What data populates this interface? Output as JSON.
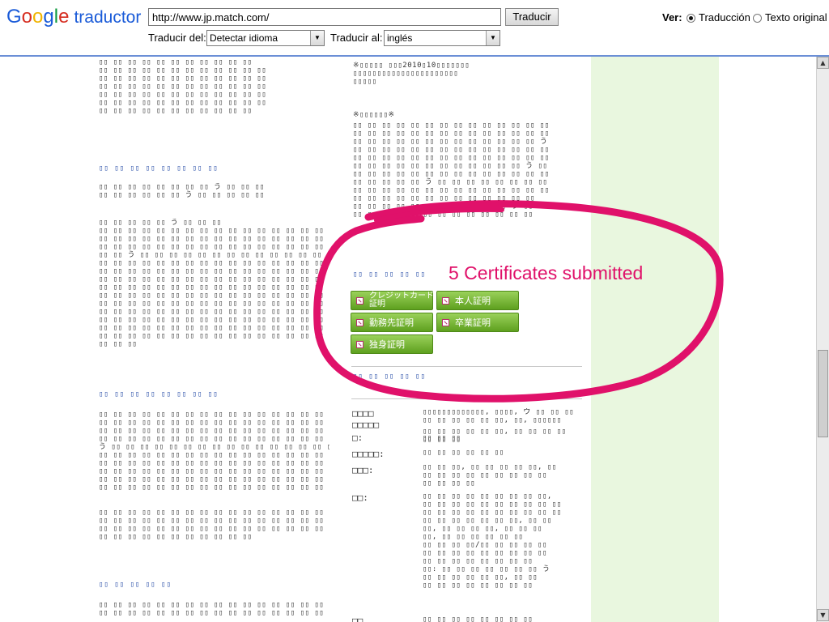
{
  "toolbar": {
    "logo_google": "Google",
    "logo_product": "traductor",
    "url_value": "http://www.jp.match.com/",
    "translate_button": "Traducir",
    "from_label": "Traducir del:",
    "from_value": "Detectar idioma",
    "to_label": "Traducir al:",
    "to_value": "inglés",
    "view_label": "Ver:",
    "view_translation": "Traducción",
    "view_original": "Texto original"
  },
  "content": {
    "left_block_1": "▯▯ ▯▯ ▯▯ ▯▯ ▯▯ ▯▯ ▯▯ ▯▯ ▯▯ ▯▯ ▯▯\n▯▯ ▯▯ ▯▯ ▯▯ ▯▯ ▯▯ ▯▯ ▯▯ ▯▯ ▯▯ ▯▯ ▯▯\n▯▯ ▯▯ ▯▯ ▯▯ ▯▯ ▯▯ ▯▯ ▯▯ ▯▯ ▯▯ ▯▯ ▯▯\n▯▯ ▯▯ ▯▯ ▯▯ ▯▯ ▯▯ ▯▯ ▯▯ ▯▯ ▯▯ ▯▯ ▯▯\n▯▯ ▯▯ ▯▯ ▯▯ ▯▯ ▯▯ ▯▯ ▯▯ ▯▯ ▯▯ ▯▯ ▯▯\n▯▯ ▯▯ ▯▯ ▯▯ ▯▯ ▯▯ ▯▯ ▯▯ ▯▯ ▯▯ ▯▯ ▯▯\n▯▯ ▯▯ ▯▯ ▯▯ ▯▯ ▯▯ ▯▯ ▯▯ ▯▯ ▯▯ ▯▯",
    "left_head_1": "▯▯ ▯▯ ▯▯ ▯▯ ▯▯ ▯▯ ▯▯ ▯▯",
    "left_block_2": "▯▯ ▯▯ ▯▯ ▯▯ ▯▯ ▯▯ ▯▯ ▯▯ う ▯▯ ▯▯ ▯▯\n▯▯ ▯▯ ▯▯ ▯▯ ▯▯ ▯▯ う ▯▯ ▯▯ ▯▯ ▯▯ ▯▯",
    "left_block_3": "▯▯ ▯▯ ▯▯ ▯▯ ▯▯ う ▯▯ ▯▯ ▯▯\n▯▯ ▯▯ ▯▯ ▯▯ ▯▯ ▯▯ ▯▯ ▯▯ ▯▯ ▯▯ ▯▯ ▯▯ ▯▯ ▯▯ ▯▯ ▯▯ ▯▯\n▯▯ ▯▯ ▯▯ ▯▯ ▯▯ ▯▯ ▯▯ ▯▯ ▯▯ ▯▯ ▯▯ ▯▯ ▯▯ ▯▯ ▯▯ ▯▯ ▯▯\n▯▯ ▯▯ ▯▯ ▯▯ ▯▯ ▯▯ ▯▯ ▯▯ ▯▯ ▯▯ ▯▯ ▯▯ ▯▯ ▯▯ ▯▯ ▯▯ ▯▯\n▯▯ ▯▯ う ▯▯ ▯▯ ▯▯ ▯▯ ▯▯ ▯▯ ▯▯ ▯▯ ▯▯ ▯▯ ▯▯ ▯▯ ▯▯ ▯▯\n▯▯ ▯▯ ▯▯ ▯▯ ▯▯ ▯▯ ▯▯ ▯▯ ▯▯ ▯▯ ▯▯ ▯▯ ▯▯ ▯▯ ▯▯ ▯▯ ▯▯\n▯▯ ▯▯ ▯▯ ▯▯ ▯▯ ▯▯ ▯▯ ▯▯ ▯▯ ▯▯ ▯▯ ▯▯ ▯▯ ▯▯ ▯▯ ▯▯ ▯▯\n▯▯ ▯▯ ▯▯ ▯▯ ▯▯ ▯▯ ▯▯ ▯▯ ▯▯ ▯▯ ▯▯ ▯▯ ▯▯ ▯▯ ▯▯ ▯▯ ▯▯\n▯▯ ▯▯ ▯▯ ▯▯ ▯▯ ▯▯ ▯▯ ▯▯ ▯▯ ▯▯ ▯▯ ▯▯ ▯▯ ▯▯ ▯▯ ▯▯ ▯▯\n▯▯ ▯▯ ▯▯ ▯▯ ▯▯ ▯▯ ▯▯ ▯▯ ▯▯ ▯▯ ▯▯ ▯▯ ▯▯ ▯▯ ▯▯ ▯▯ ▯▯\n▯▯ ▯▯ ▯▯ ▯▯ ▯▯ ▯▯ ▯▯ ▯▯ ▯▯ ▯▯ ▯▯ ▯▯ ▯▯ ▯▯ ▯▯ ▯▯ ▯▯\n▯▯ ▯▯ ▯▯ ▯▯ ▯▯ ▯▯ ▯▯ ▯▯ ▯▯ ▯▯ ▯▯ ▯▯ ▯▯ ▯▯ ▯▯ ▯▯ ▯▯\n▯▯ ▯▯ ▯▯ ▯▯ ▯▯ ▯▯ ▯▯ ▯▯ ▯▯ ▯▯ ▯▯ ▯▯ ▯▯ ▯▯ ▯▯ ▯▯ ▯▯\n▯▯ ▯▯ ▯▯ ▯▯ ▯▯ ▯▯ ▯▯ ▯▯ ▯▯ ▯▯ ▯▯ ▯▯ ▯▯ ▯▯ ▯▯ ▯▯ ▯▯\n▯▯ ▯▯ ▯▯ ▯▯ ▯▯ ▯▯ ▯▯ ▯▯ ▯▯ ▯▯ ▯▯ ▯▯ ▯▯ ▯▯ ▯▯ ▯▯ ▯▯\n▯▯ ▯▯ ▯▯",
    "left_head_2": "▯▯ ▯▯ ▯▯ ▯▯ ▯▯ ▯▯ ▯▯ ▯▯",
    "left_block_4": "▯▯ ▯▯ ▯▯ ▯▯ ▯▯ ▯▯ ▯▯ ▯▯ ▯▯ ▯▯ ▯▯ ▯▯ ▯▯ ▯▯ ▯▯ ▯▯ ▯▯\n▯▯ ▯▯ ▯▯ ▯▯ ▯▯ ▯▯ ▯▯ ▯▯ ▯▯ ▯▯ ▯▯ ▯▯ ▯▯ ▯▯ ▯▯ ▯▯ ▯▯\n▯▯ ▯▯ ▯▯ ▯▯ ▯▯ ▯▯ ▯▯ ▯▯ ▯▯ ▯▯ ▯▯ ▯▯ ▯▯ ▯▯ ▯▯ ▯▯ ▯▯\n▯▯ ▯▯ ▯▯ ▯▯ ▯▯ ▯▯ ▯▯ ▯▯ ▯▯ ▯▯ ▯▯ ▯▯ ▯▯ ▯▯ ▯▯ ▯▯ ▯▯\nう ▯▯ ▯▯ ▯▯ ▯▯ ▯▯ ▯▯ ▯▯ ▯▯ ▯▯ ▯▯ ▯▯ ▯▯ ▯▯ ▯▯ ▯▯ ▯▯\n▯▯ ▯▯ ▯▯ ▯▯ ▯▯ ▯▯ ▯▯ ▯▯ ▯▯ ▯▯ ▯▯ ▯▯ ▯▯ ▯▯ ▯▯ ▯▯ ▯▯\n▯▯ ▯▯ ▯▯ ▯▯ ▯▯ ▯▯ ▯▯ ▯▯ ▯▯ ▯▯ ▯▯ ▯▯ ▯▯ ▯▯ ▯▯ ▯▯ ▯▯\n▯▯ ▯▯ ▯▯ ▯▯ ▯▯ ▯▯ ▯▯ ▯▯ ▯▯ ▯▯ ▯▯ ▯▯ ▯▯ ▯▯ ▯▯ ▯▯ ▯▯\n▯▯ ▯▯ ▯▯ ▯▯ ▯▯ ▯▯ ▯▯ ▯▯ ▯▯ ▯▯ ▯▯ ▯▯ ▯▯ ▯▯ ▯▯ ▯▯ ▯▯\n▯▯ ▯▯ ▯▯ ▯▯ ▯▯ ▯▯ ▯▯ ▯▯ ▯▯ ▯▯ ▯▯ ▯▯ ▯▯ ▯▯ ▯▯ ▯▯",
    "left_block_5": "▯▯ ▯▯ ▯▯ ▯▯ ▯▯ ▯▯ ▯▯ ▯▯ ▯▯ ▯▯ ▯▯ ▯▯ ▯▯ ▯▯ ▯▯ ▯▯ ▯▯\n▯▯ ▯▯ ▯▯ ▯▯ ▯▯ ▯▯ ▯▯ ▯▯ ▯▯ ▯▯ ▯▯ ▯▯ ▯▯ ▯▯ ▯▯ ▯▯ ▯▯\n▯▯ ▯▯ ▯▯ ▯▯ ▯▯ ▯▯ ▯▯ ▯▯ ▯▯ ▯▯ ▯▯ ▯▯ ▯▯ ▯▯ ▯▯ ▯▯ ▯▯\n▯▯ ▯▯ ▯▯ ▯▯ ▯▯ ▯▯ ▯▯ ▯▯ ▯▯ ▯▯ ▯▯",
    "left_head_3": "▯▯ ▯▯ ▯▯ ▯▯ ▯▯",
    "left_block_6": "▯▯ ▯▯ ▯▯ ▯▯ ▯▯ ▯▯ ▯▯ ▯▯ ▯▯ ▯▯ ▯▯ ▯▯ ▯▯ ▯▯ ▯▯ ▯▯ ▯▯\n▯▯ ▯▯ ▯▯ ▯▯ ▯▯ ▯▯ ▯▯ ▯▯ ▯▯ ▯▯ ▯▯ ▯▯ ▯▯ ▯▯ ▯▯ ▯▯ ▯▯",
    "right_notice_1": "※▯▯▯▯▯ ▯▯▯2010▯10▯▯▯▯▯▯▯\n▯▯▯▯▯▯▯▯▯▯▯▯▯▯▯▯▯▯▯▯▯▯\n▯▯▯▯▯",
    "right_notice_2_head": "※▯▯▯▯▯▯※",
    "right_block_2": "▯▯ ▯▯ ▯▯ ▯▯ ▯▯ ▯▯ ▯▯ ▯▯ ▯▯ ▯▯ ▯▯ ▯▯ ▯▯ ▯▯\n▯▯ ▯▯ ▯▯ ▯▯ ▯▯ ▯▯ ▯▯ ▯▯ ▯▯ ▯▯ ▯▯ ▯▯ ▯▯ ▯▯\n▯▯ ▯▯ ▯▯ ▯▯ ▯▯ ▯▯ ▯▯ ▯▯ ▯▯ ▯▯ ▯▯ ▯▯ ▯▯ う\n▯▯ ▯▯ ▯▯ ▯▯ ▯▯ ▯▯ ▯▯ ▯▯ ▯▯ ▯▯ ▯▯ ▯▯ ▯▯ ▯▯\n▯▯ ▯▯ ▯▯ ▯▯ ▯▯ ▯▯ ▯▯ ▯▯ ▯▯ ▯▯ ▯▯ ▯▯ ▯▯ ▯▯\n▯▯ ▯▯ ▯▯ ▯▯ ▯▯ ▯▯ ▯▯ ▯▯ ▯▯ ▯▯ ▯▯ ▯▯ う ▯▯\n▯▯ ▯▯ ▯▯ ▯▯ ▯▯ ▯▯ ▯▯ ▯▯ ▯▯ ▯▯ ▯▯ ▯▯ ▯▯ ▯▯\n▯▯ ▯▯ ▯▯ ▯▯ ▯▯ う ▯▯ ▯▯ ▯▯ ▯▯ ▯▯ ▯▯ ▯▯ ▯▯\n▯▯ ▯▯ ▯▯ ▯▯ ▯▯ ▯▯ ▯▯ ▯▯ ▯▯ ▯▯ ▯▯ ▯▯ ▯▯ ▯▯\n▯▯ ▯▯ ▯▯ ▯▯ ▯▯ ▯▯ ▯▯ ▯▯ ▯▯ ▯▯ ▯▯ ▯▯ ▯▯\n▯▯ ▯▯ ▯▯ ▯▯ ▯▯ ▯▯ ▯▯ ▯▯ ▯▯ ▯▯ ▯▯ う ▯▯\n▯▯ ▯▯ ウ ▯▯ ▯▯ ▯▯ ▯▯ ▯▯ ▯▯ ▯▯ ▯▯ ▯▯ ▯▯",
    "right_cert_head": "▯▯ ▯▯ ▯▯ ▯▯ ▯▯",
    "right_head_below": "▯▯ ▯▯ ▯▯ ▯▯ ▯▯",
    "table_rows": [
      {
        "label": "□□□□",
        "value": "▯▯▯▯▯▯▯▯▯▯▯▯▯, ▯▯▯▯, ウ ▯▯ ▯▯ ▯▯\n▯▯ ▯▯ ▯▯ ▯▯ ▯▯ ▯▯, ▯▯, ▯▯▯▯▯▯"
      },
      {
        "label": "□□□□□",
        "value": "▯▯ ▯▯ ▯▯ ▯▯ ▯▯ ▯▯, ▯▯ ▯▯ ▯▯ ▯▯\n▯▯ ▯▯ ▯▯"
      },
      {
        "label": "□:",
        "value": "▯▯ ▯▯ ▯▯"
      },
      {
        "label": "□□□□□:",
        "value": "▯▯ ▯▯ ▯▯ ▯▯ ▯▯ ▯▯"
      },
      {
        "label": "□□□:",
        "value": "▯▯ ▯▯ ▯▯, ▯▯ ▯▯ ▯▯ ▯▯ ▯▯, ▯▯\n▯▯ ▯▯ ▯▯ ▯▯ ▯▯ ▯▯ ▯▯ ▯▯ ▯▯\n▯▯ ▯▯ ▯▯ ▯▯"
      },
      {
        "label": "□□:",
        "value": "▯▯ ▯▯ ▯▯ ▯▯ ▯▯ ▯▯ ▯▯ ▯▯ ▯▯,\n▯▯ ▯▯ ▯▯ ▯▯ ▯▯ ▯▯ ▯▯ ▯▯ ▯▯ ▯▯\n▯▯ ▯▯ ▯▯ ▯▯ ▯▯ ▯▯ ▯▯ ▯▯ ▯▯ ▯▯\n▯▯ ▯▯ ▯▯ ▯▯ ▯▯ ▯▯ ▯▯, ▯▯ ▯▯\n▯▯, ▯▯ ▯▯ ▯▯ ▯▯, ▯▯ ▯▯ ▯▯\n▯▯, ▯▯ ▯▯ ▯▯ ▯▯ ▯▯ ▯▯\n▯▯ ▯▯ ▯▯ ▯▯/▯▯ ▯▯ ▯▯ ▯▯ ▯▯\n▯▯ ▯▯ ▯▯ ▯▯ ▯▯ ▯▯ ▯▯ ▯▯ ▯▯\n▯▯ ▯▯ ▯▯ ▯▯ ▯▯ ▯▯ ▯▯ ▯▯\n▯▯: ▯▯ ▯▯ ▯▯ ▯▯ ▯▯ ▯▯ ▯▯ う\n▯▯ ▯▯ ▯▯ ▯▯ ▯▯ ▯▯, ▯▯ ▯▯\n▯▯ ▯▯ ▯▯ ▯▯ ▯▯ ▯▯ ▯▯ ▯▯"
      },
      {
        "label": "□□",
        "value": "▯▯ ▯▯ ▯▯ ▯▯ ▯▯ ▯▯ ▯▯ ▯▯"
      }
    ]
  },
  "certificates": {
    "annotation": "5 Certificates submitted",
    "buttons": [
      {
        "label": "クレジットカード\n証明"
      },
      {
        "label": "本人証明"
      },
      {
        "label": "勤務先証明"
      },
      {
        "label": "卒業証明"
      },
      {
        "label": "独身証明"
      }
    ]
  },
  "colors": {
    "annotation": "#e0116a",
    "cert_button": "#6fb12e",
    "side_column": "#e9f7df"
  }
}
